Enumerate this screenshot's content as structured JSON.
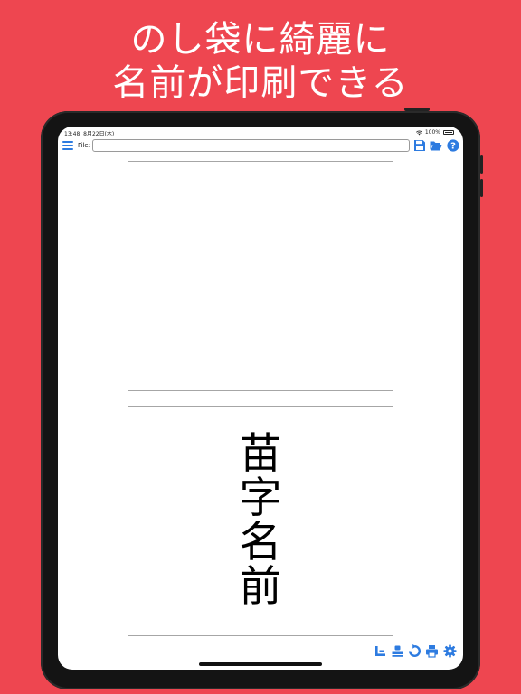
{
  "headline": {
    "line1": "のし袋に綺麗に",
    "line2": "名前が印刷できる"
  },
  "status_bar": {
    "time": "13:48",
    "date": "8月22日(木)",
    "battery": "100%"
  },
  "toolbar": {
    "file_label": "File:",
    "file_value": "",
    "icons": [
      "menu-icon",
      "save-icon",
      "folder-open-icon",
      "help-icon"
    ]
  },
  "document": {
    "name_chars": [
      "苗",
      "字",
      "名",
      "前"
    ]
  },
  "bottom_tools": {
    "icons": [
      "layout-icon",
      "stamp-icon",
      "rotate-icon",
      "print-icon",
      "settings-icon"
    ]
  },
  "colors": {
    "background": "#ee4650",
    "accent": "#2d7be0"
  }
}
